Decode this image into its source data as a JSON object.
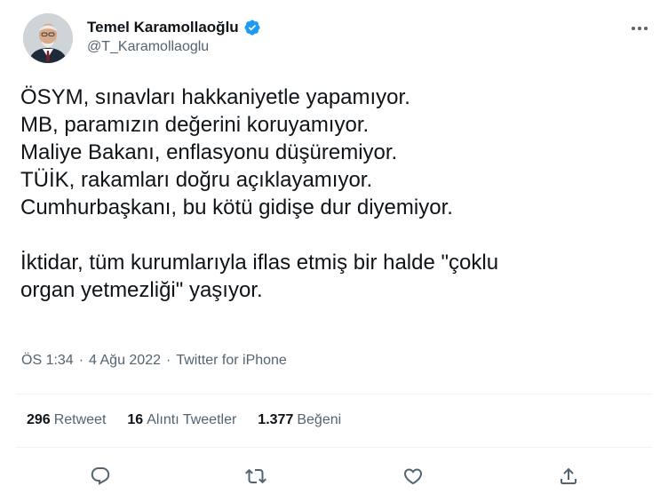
{
  "author": {
    "display_name": "Temel Karamollaoğlu",
    "handle": "@T_Karamollaoglu",
    "verified": true
  },
  "tweet": {
    "lines": [
      "ÖSYM, sınavları hakkaniyetle yapamıyor.",
      "MB, paramızın değerini koruyamıyor.",
      "Maliye Bakanı, enflasyonu düşüremiyor.",
      "TÜİK, rakamları doğru açıklayamıyor.",
      "Cumhurbaşkanı, bu kötü gidişe dur diyemiyor.",
      "İktidar, tüm kurumlarıyla iflas etmiş bir halde \"çoklu",
      "organ yetmezliği\" yaşıyor."
    ]
  },
  "meta": {
    "time": "ÖS 1:34",
    "sep1": "·",
    "date": "4 Ağu 2022",
    "sep2": "·",
    "source": "Twitter for iPhone"
  },
  "stats": {
    "retweets": {
      "count": "296",
      "label": "Retweet"
    },
    "quotes": {
      "count": "16",
      "label": "Alıntı Tweetler"
    },
    "likes": {
      "count": "1.377",
      "label": "Beğeni"
    }
  },
  "colors": {
    "text": "#0f1419",
    "secondary": "#536471",
    "verified": "#1d9bf0",
    "divider": "#eff3f4"
  },
  "icons": {
    "more": "more-horizontal-icon",
    "verified": "verified-badge-icon",
    "reply": "reply-icon",
    "retweet": "retweet-icon",
    "like": "like-icon",
    "share": "share-icon"
  }
}
